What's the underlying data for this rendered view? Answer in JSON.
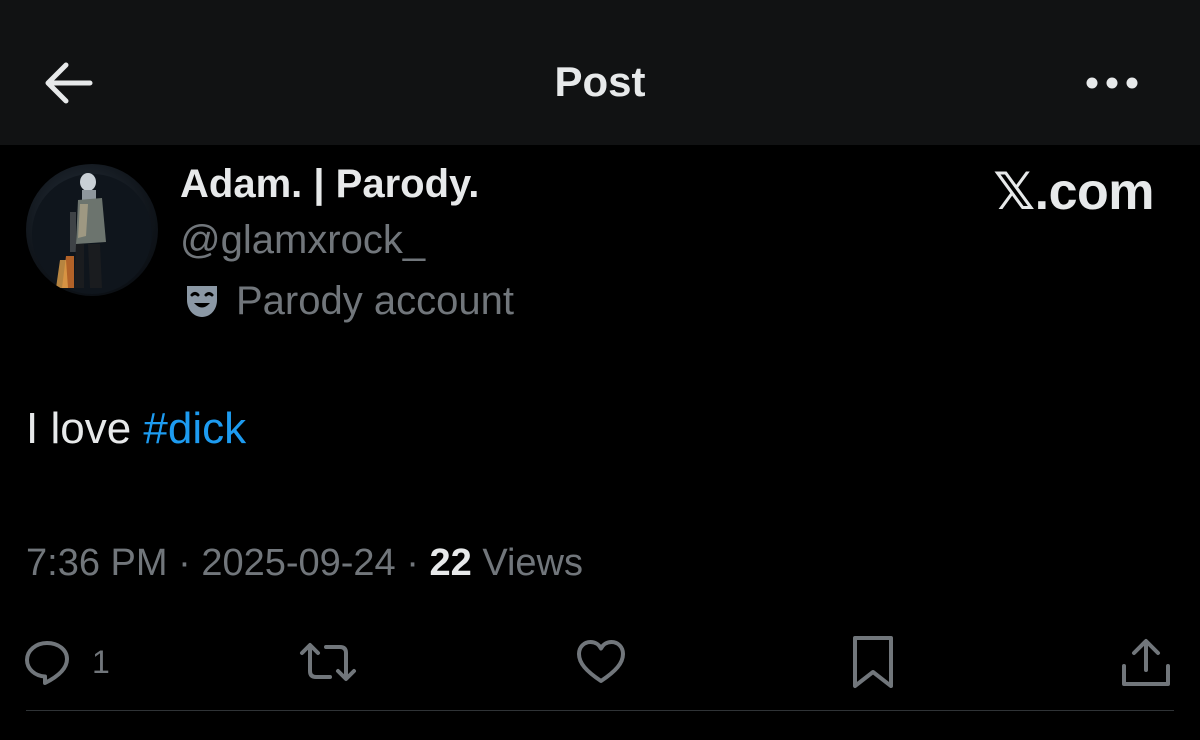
{
  "header": {
    "title": "Post",
    "back_icon": "arrow-left-icon",
    "more_icon": "ellipsis-icon"
  },
  "author": {
    "display_name": "Adam. | Parody.",
    "handle": "@glamxrock_",
    "label": "Parody account",
    "label_icon": "theater-mask-icon"
  },
  "brand": {
    "logo_text": "𝕏.com"
  },
  "post": {
    "text_prefix": "I love ",
    "hashtag": "#dick"
  },
  "meta": {
    "time": "7:36 PM",
    "separator_1": " · ",
    "date": "2025-09-24",
    "separator_2": " · ",
    "views_count": "22",
    "views_label": " Views"
  },
  "actions": {
    "reply_count": "1",
    "reply_icon": "reply-bubble-icon",
    "repost_icon": "repost-icon",
    "like_icon": "heart-icon",
    "bookmark_icon": "bookmark-icon",
    "share_icon": "share-upload-icon"
  },
  "colors": {
    "background": "#000000",
    "header_bg": "#111213",
    "primary_text": "#e7e9ea",
    "secondary_text": "#71767b",
    "link": "#1d9bf0",
    "divider": "#2f3336"
  }
}
